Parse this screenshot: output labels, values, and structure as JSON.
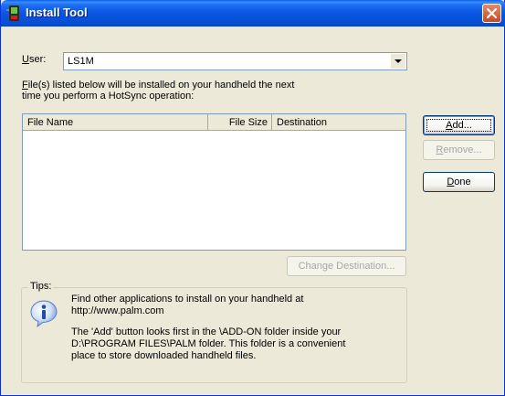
{
  "window": {
    "title": "Install Tool"
  },
  "user": {
    "label_underline": "U",
    "label_rest": "ser:",
    "value": "LS1M"
  },
  "instructions": {
    "line1_underline": "F",
    "line1_rest": "ile(s) listed below will be installed on your handheld the next",
    "line2": "time you perform a HotSync operation:"
  },
  "file_list": {
    "columns": [
      "File Name",
      "File Size",
      "Destination"
    ],
    "rows": []
  },
  "buttons": {
    "add": {
      "underline": "A",
      "rest": "dd..."
    },
    "remove": {
      "underline": "R",
      "rest": "emove..."
    },
    "done": {
      "underline": "D",
      "rest": "one"
    },
    "change_destination": "Change Destination..."
  },
  "tips": {
    "legend": "Tips:",
    "line1": "Find other applications to install on your handheld at",
    "line2": "http://www.palm.com",
    "line3": "The 'Add' button looks first in the \\ADD-ON folder inside your",
    "line4": "D:\\PROGRAM FILES\\PALM folder. This folder is a convenient",
    "line5": "place to store downloaded handheld files."
  },
  "icons": {
    "app": "palm-handheld-icon",
    "close": "close-icon",
    "info": "info-icon",
    "dropdown": "chevron-down-icon"
  }
}
